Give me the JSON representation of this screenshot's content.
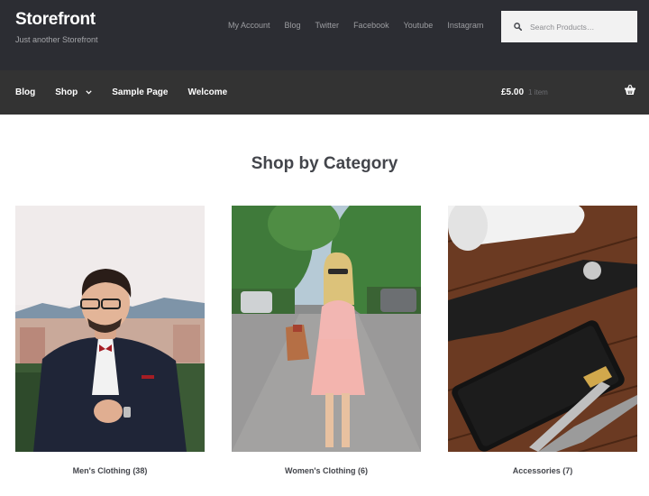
{
  "site": {
    "title": "Storefront",
    "tagline": "Just another Storefront"
  },
  "secondary_nav": [
    "My Account",
    "Blog",
    "Twitter",
    "Facebook",
    "Youtube",
    "Instagram"
  ],
  "search": {
    "placeholder": "Search Products…",
    "icon": "search-icon"
  },
  "primary_nav": {
    "blog": "Blog",
    "shop": "Shop",
    "sample_page": "Sample Page",
    "welcome": "Welcome"
  },
  "cart": {
    "amount": "£5.00",
    "count": "1 item",
    "icon": "basket-icon"
  },
  "main": {
    "heading": "Shop by Category",
    "categories": [
      {
        "name": "Men's Clothing",
        "count": "(38)"
      },
      {
        "name": "Women's Clothing",
        "count": "(6)"
      },
      {
        "name": "Accessories",
        "count": "(7)"
      }
    ]
  },
  "colors": {
    "header_bg": "#2c2d33",
    "nav_bg": "#333333",
    "text": "#43454b"
  }
}
